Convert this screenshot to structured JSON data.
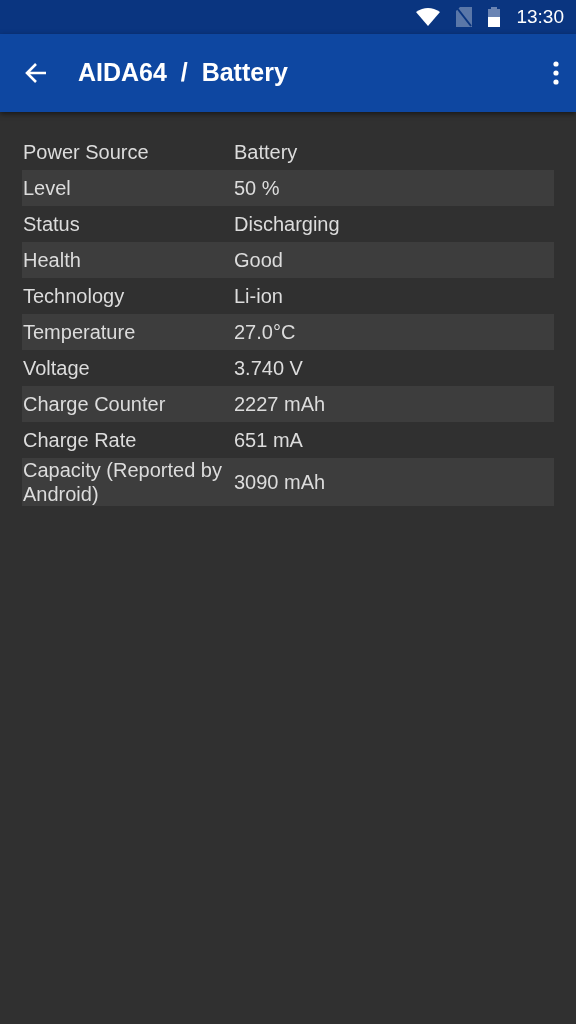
{
  "status_bar": {
    "time": "13:30"
  },
  "app_bar": {
    "title": "AIDA64  /  Battery"
  },
  "rows": [
    {
      "label": "Power Source",
      "value": "Battery"
    },
    {
      "label": "Level",
      "value": "50 %"
    },
    {
      "label": "Status",
      "value": "Discharging"
    },
    {
      "label": "Health",
      "value": "Good"
    },
    {
      "label": "Technology",
      "value": "Li-ion"
    },
    {
      "label": "Temperature",
      "value": "27.0°C"
    },
    {
      "label": "Voltage",
      "value": "3.740 V"
    },
    {
      "label": "Charge Counter",
      "value": "2227 mAh"
    },
    {
      "label": "Charge Rate",
      "value": "651 mA"
    },
    {
      "label": "Capacity (Reported by Android)",
      "value": "3090 mAh"
    }
  ]
}
